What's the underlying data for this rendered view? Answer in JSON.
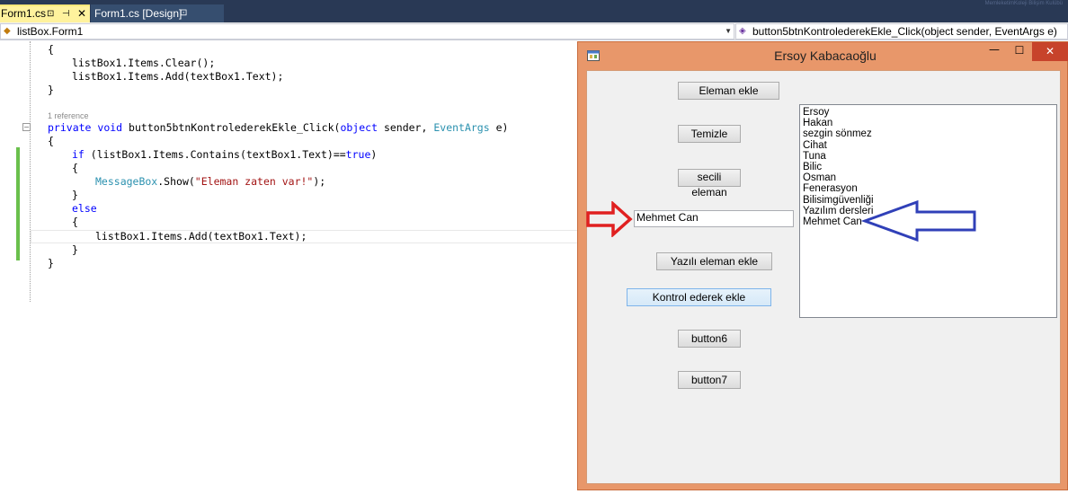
{
  "ide": {
    "tabs": [
      {
        "label": "Form1.cs",
        "active": true
      },
      {
        "label": "Form1.cs [Design]",
        "active": false
      }
    ],
    "tab_pin_glyph": "⊡",
    "tab_autohide_glyph": "⊣",
    "tab_close_glyph": "✕",
    "tab_lock_glyph": "⊡",
    "watermark": "MemleketimKoleji Bilişim Kulübü",
    "nav_left": "listBox.Form1",
    "nav_right": "button5btnKontrolederekEkle_Click(object sender, EventArgs e)",
    "nav_drop_glyph": "▼"
  },
  "code": {
    "reference_hint": "1 reference",
    "lines": {
      "l1": "{",
      "l2": "listBox1.Items.Clear();",
      "l3": "listBox1.Items.Add(textBox1.Text);",
      "l4": "}",
      "method_kw1": "private",
      "method_kw2": "void",
      "method_name": "button5btnKontrolederekEkle_Click(",
      "method_kw3": "object",
      "method_arg1": "sender,",
      "method_ty": "EventArgs",
      "method_arg2": "e)",
      "l6": "{",
      "if_kw": "if",
      "if_cond": "(listBox1.Items.Contains(textBox1.Text)==",
      "if_true": "true",
      "if_close": ")",
      "l8": "{",
      "msg_ty": "MessageBox",
      "msg_call": ".Show(",
      "msg_str": "\"Eleman zaten var!\"",
      "msg_end": ");",
      "l10": "}",
      "else_kw": "else",
      "l12": "{",
      "l13": "listBox1.Items.Add(textBox1.Text);",
      "l14": "}",
      "l15": "}"
    }
  },
  "form": {
    "title": "Ersoy Kabacaoğlu",
    "min_glyph": "—",
    "max_glyph": "☐",
    "close_glyph": "✕",
    "buttons": {
      "eleman_ekle": "Eleman ekle",
      "temizle": "Temizle",
      "secili_eleman": "secili eleman",
      "yazili_eleman_ekle": "Yazılı eleman ekle",
      "kontrol_ederek_ekle": "Kontrol ederek ekle",
      "button6": "button6",
      "button7": "button7"
    },
    "textbox_value": "Mehmet Can",
    "listbox_items": [
      "Ersoy",
      "Hakan",
      "sezgin sönmez",
      "Cihat",
      "Tuna",
      "Bilic",
      "Osman",
      "Fenerasyon",
      "Bilisimgüvenliği",
      "Yazılım dersleri",
      "Mehmet Can"
    ]
  },
  "annotations": {
    "red_arrow_color": "#e02020",
    "blue_arrow_color": "#3040b8"
  }
}
